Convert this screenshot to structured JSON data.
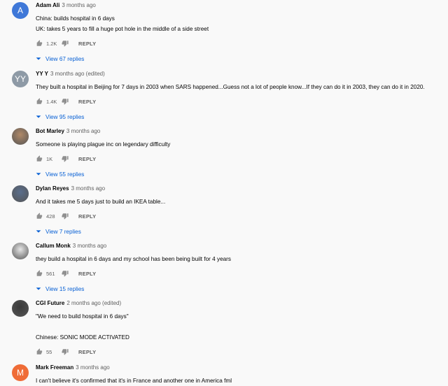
{
  "comments": [
    {
      "author": "Adam Ali",
      "time": "3 months ago",
      "avatar": {
        "letter": "A",
        "color": "#3f78d8"
      },
      "lines": [
        "China: builds hospital in 6 days",
        "UK: takes 5 years to fill a huge pot hole in the middle of a side street"
      ],
      "likes": "1.2K",
      "reply_label": "REPLY",
      "replies_label": "View 67 replies"
    },
    {
      "author": "YY Y",
      "time": "3 months ago (edited)",
      "avatar": {
        "letter": "YY",
        "color": "#8e9aa6"
      },
      "lines": [
        "They built a hospital in Beijing for 7 days in 2003 when SARS happened...Guess not a lot of people know...If they can do it in 2003, they can do it in 2020."
      ],
      "likes": "1.4K",
      "reply_label": "REPLY",
      "replies_label": "View 95 replies"
    },
    {
      "author": "Bot Marley",
      "time": "3 months ago",
      "avatar": {
        "letter": "",
        "color": "#b08968"
      },
      "lines": [
        "Someone is playing plague inc on legendary difficulty"
      ],
      "likes": "1K",
      "reply_label": "REPLY",
      "replies_label": "View 55 replies"
    },
    {
      "author": "Dylan Reyes",
      "time": "3 months ago",
      "avatar": {
        "letter": "",
        "color": "#5a6e8c"
      },
      "lines": [
        "And it takes me 5 days just to build an IKEA table..."
      ],
      "likes": "428",
      "reply_label": "REPLY",
      "replies_label": "View 7 replies"
    },
    {
      "author": "Callum Monk",
      "time": "3 months ago",
      "avatar": {
        "letter": "",
        "color": "#e6e6e6"
      },
      "lines": [
        "they build a hospital in 6 days and my school has been being built for 4 years"
      ],
      "likes": "561",
      "reply_label": "REPLY",
      "replies_label": "View 15 replies"
    },
    {
      "author": "CGI Future",
      "time": "2 months ago (edited)",
      "avatar": {
        "letter": "",
        "color": "#3a3a3a"
      },
      "lines": [
        "\"We need to build hospital in 6 days\"",
        "",
        "Chinese: SONIC MODE ACTIVATED"
      ],
      "likes": "55",
      "reply_label": "REPLY",
      "replies_label": ""
    },
    {
      "author": "Mark Freeman",
      "time": "3 months ago",
      "avatar": {
        "letter": "M",
        "color": "#ef6c37"
      },
      "lines": [
        "I can't believe it's confirmed that it's in France and another one in America fml"
      ],
      "likes": "",
      "reply_label": "",
      "replies_label": ""
    }
  ]
}
